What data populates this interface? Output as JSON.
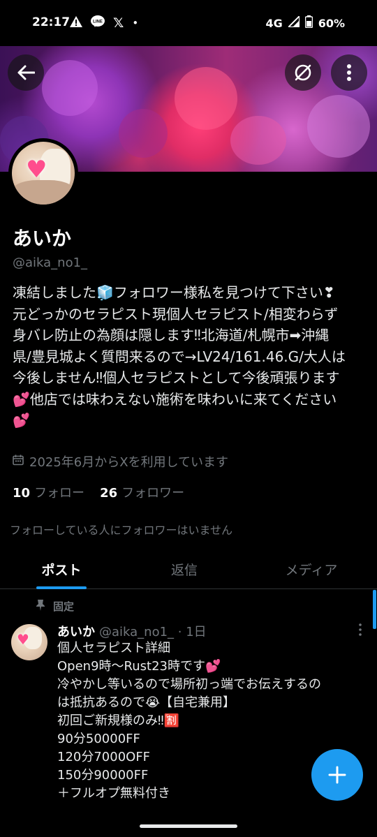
{
  "status": {
    "time": "22:17",
    "network": "4G",
    "battery": "60%"
  },
  "profile": {
    "name": "あいか",
    "handle": "@aika_no1_",
    "bio_lines": [
      "凍結しました🧊フォロワー様私を見つけて下さい❣",
      "元どっかのセラピスト現個人セラピスト/相変わらず",
      "身バレ防止の為顔は隠します‼北海道/札幌市➡沖縄",
      "県/豊見城よく質問来るので→LV24/161.46.G/大人は",
      "今後しません‼個人セラピストとして今後頑張ります",
      "💕他店では味わえない施術を味わいに来てください",
      "💕"
    ],
    "joined": "2025年6月からXを利用しています",
    "following_count": "10",
    "following_label": "フォロー",
    "followers_count": "26",
    "followers_label": "フォロワー",
    "no_mutual": "フォローしている人にフォロワーはいません"
  },
  "tabs": [
    "ポスト",
    "返信",
    "メディア"
  ],
  "pinned_post": {
    "pinned_label": "固定",
    "name": "あいか",
    "handle": "@aika_no1_",
    "time": "· 1日",
    "lines": [
      "個人セラピスト詳細",
      "Open9時〜Rust23時です💕",
      "冷やかし等いるので場所初っ端でお伝えするの",
      "は抵抗あるので😭【自宅兼用】",
      "初回ご新規様のみ‼🈹",
      "90分50000FF",
      "120分7000OFF",
      "150分90000FF",
      "＋フルオプ無料付き"
    ]
  },
  "colors": {
    "accent": "#1d9bf0",
    "muted": "#71767b",
    "text": "#e7e9ea"
  }
}
